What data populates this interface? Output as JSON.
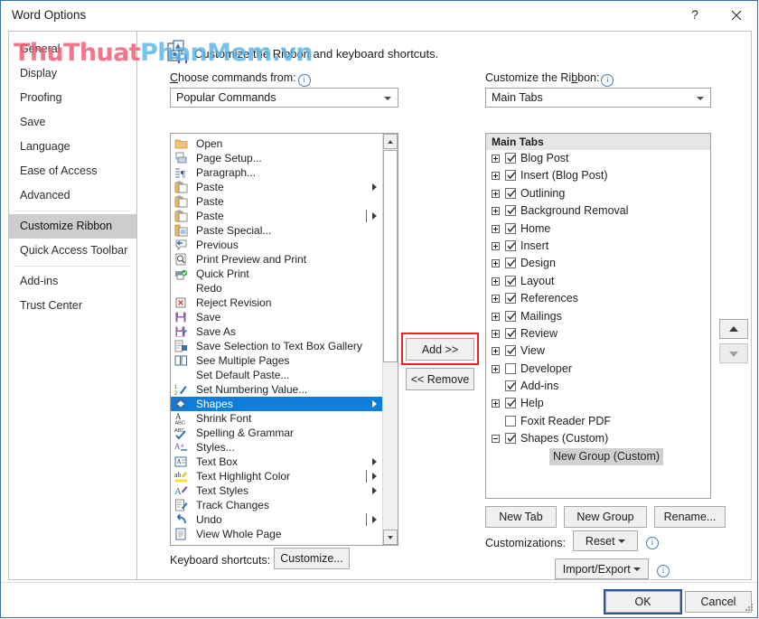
{
  "window": {
    "title": "Word Options",
    "help_button": "?",
    "close_button": "✕"
  },
  "watermark": {
    "red_text": "ThuThuat",
    "blue_text": "PhanMem.vn"
  },
  "nav": {
    "items": [
      {
        "label": "General",
        "selected": false
      },
      {
        "label": "Display",
        "selected": false
      },
      {
        "label": "Proofing",
        "selected": false
      },
      {
        "label": "Save",
        "selected": false
      },
      {
        "label": "Language",
        "selected": false
      },
      {
        "label": "Ease of Access",
        "selected": false
      },
      {
        "label": "Advanced",
        "selected": false
      },
      {
        "label": "Customize Ribbon",
        "selected": true
      },
      {
        "label": "Quick Access Toolbar",
        "selected": false
      },
      {
        "label": "Add-ins",
        "selected": false
      },
      {
        "label": "Trust Center",
        "selected": false
      }
    ]
  },
  "header": {
    "description": "Customize the Ribbon and keyboard shortcuts.",
    "icon": "customize-ribbon-icon"
  },
  "left_panel": {
    "choose_label": "Choose commands from:",
    "choose_info_icon": "info-icon",
    "combo_value": "Popular Commands",
    "commands": [
      {
        "label": "Open",
        "icon": "folder-open-icon",
        "submenu": false,
        "divider": false
      },
      {
        "label": "Page Setup...",
        "icon": "page-setup-icon",
        "submenu": false,
        "divider": false
      },
      {
        "label": "Paragraph...",
        "icon": "paragraph-icon",
        "submenu": false,
        "divider": false
      },
      {
        "label": "Paste",
        "icon": "paste-icon",
        "submenu": true,
        "divider": false
      },
      {
        "label": "Paste",
        "icon": "paste-icon",
        "submenu": false,
        "divider": false
      },
      {
        "label": "Paste",
        "icon": "paste-icon",
        "submenu": true,
        "divider": true
      },
      {
        "label": "Paste Special...",
        "icon": "paste-special-icon",
        "submenu": false,
        "divider": false
      },
      {
        "label": "Previous",
        "icon": "previous-comment-icon",
        "submenu": false,
        "divider": false
      },
      {
        "label": "Print Preview and Print",
        "icon": "print-preview-icon",
        "submenu": false,
        "divider": false
      },
      {
        "label": "Quick Print",
        "icon": "quick-print-icon",
        "submenu": false,
        "divider": false
      },
      {
        "label": "Redo",
        "icon": "none",
        "submenu": false,
        "divider": false
      },
      {
        "label": "Reject Revision",
        "icon": "reject-revision-icon",
        "submenu": false,
        "divider": false
      },
      {
        "label": "Save",
        "icon": "save-icon",
        "submenu": false,
        "divider": false
      },
      {
        "label": "Save As",
        "icon": "save-as-icon",
        "submenu": false,
        "divider": false
      },
      {
        "label": "Save Selection to Text Box Gallery",
        "icon": "save-selection-icon",
        "submenu": false,
        "divider": false
      },
      {
        "label": "See Multiple Pages",
        "icon": "multiple-pages-icon",
        "submenu": false,
        "divider": false
      },
      {
        "label": "Set Default Paste...",
        "icon": "none",
        "submenu": false,
        "divider": false
      },
      {
        "label": "Set Numbering Value...",
        "icon": "numbering-value-icon",
        "submenu": false,
        "divider": false
      },
      {
        "label": "Shapes",
        "icon": "shapes-icon",
        "submenu": true,
        "divider": false,
        "selected": true
      },
      {
        "label": "Shrink Font",
        "icon": "shrink-font-icon",
        "submenu": false,
        "divider": false
      },
      {
        "label": "Spelling & Grammar",
        "icon": "spelling-grammar-icon",
        "submenu": false,
        "divider": false
      },
      {
        "label": "Styles...",
        "icon": "styles-icon",
        "submenu": false,
        "divider": false
      },
      {
        "label": "Text Box",
        "icon": "text-box-icon",
        "submenu": true,
        "divider": false
      },
      {
        "label": "Text Highlight Color",
        "icon": "text-highlight-icon",
        "submenu": true,
        "divider": true
      },
      {
        "label": "Text Styles",
        "icon": "text-styles-icon",
        "submenu": true,
        "divider": false
      },
      {
        "label": "Track Changes",
        "icon": "track-changes-icon",
        "submenu": false,
        "divider": false
      },
      {
        "label": "Undo",
        "icon": "undo-icon",
        "submenu": true,
        "divider": true
      },
      {
        "label": "View Whole Page",
        "icon": "view-whole-page-icon",
        "submenu": false,
        "divider": false
      }
    ],
    "keyboard_shortcuts_label": "Keyboard shortcuts:",
    "customize_button": "Customize..."
  },
  "middle": {
    "add_button": "Add >>",
    "remove_button": "<< Remove",
    "highlight_color": "#ee2222"
  },
  "right_panel": {
    "customize_label": "Customize the Ribbon:",
    "customize_info_icon": "info-icon",
    "combo_value": "Main Tabs",
    "tree_header": "Main Tabs",
    "tree": [
      {
        "label": "Blog Post",
        "expander": "plus",
        "checkbox": "checked",
        "level": 0
      },
      {
        "label": "Insert (Blog Post)",
        "expander": "plus",
        "checkbox": "checked",
        "level": 0
      },
      {
        "label": "Outlining",
        "expander": "plus",
        "checkbox": "checked",
        "level": 0
      },
      {
        "label": "Background Removal",
        "expander": "plus",
        "checkbox": "checked",
        "level": 0
      },
      {
        "label": "Home",
        "expander": "plus",
        "checkbox": "checked",
        "level": 0
      },
      {
        "label": "Insert",
        "expander": "plus",
        "checkbox": "checked",
        "level": 0
      },
      {
        "label": "Design",
        "expander": "plus",
        "checkbox": "checked",
        "level": 0
      },
      {
        "label": "Layout",
        "expander": "plus",
        "checkbox": "checked",
        "level": 0
      },
      {
        "label": "References",
        "expander": "plus",
        "checkbox": "checked",
        "level": 0
      },
      {
        "label": "Mailings",
        "expander": "plus",
        "checkbox": "checked",
        "level": 0
      },
      {
        "label": "Review",
        "expander": "plus",
        "checkbox": "checked",
        "level": 0
      },
      {
        "label": "View",
        "expander": "plus",
        "checkbox": "checked",
        "level": 0
      },
      {
        "label": "Developer",
        "expander": "plus",
        "checkbox": "unchecked",
        "level": 0
      },
      {
        "label": "Add-ins",
        "expander": "none",
        "checkbox": "checked",
        "level": 0
      },
      {
        "label": "Help",
        "expander": "plus",
        "checkbox": "checked",
        "level": 0
      },
      {
        "label": "Foxit Reader PDF",
        "expander": "none",
        "checkbox": "unchecked",
        "level": 0
      },
      {
        "label": "Shapes (Custom)",
        "expander": "minus",
        "checkbox": "checked",
        "level": 0
      },
      {
        "label": "New Group (Custom)",
        "expander": "none",
        "checkbox": "none",
        "level": 1,
        "selected": true
      }
    ],
    "move_up_icon": "move-up-arrow-icon",
    "move_down_icon": "move-down-arrow-icon",
    "new_tab_button": "New Tab",
    "new_group_button": "New Group",
    "rename_button": "Rename...",
    "customizations_label": "Customizations:",
    "reset_button": "Reset",
    "reset_info_icon": "info-icon",
    "import_export_button": "Import/Export",
    "import_export_info_icon": "info-icon"
  },
  "footer": {
    "ok_button": "OK",
    "cancel_button": "Cancel"
  }
}
